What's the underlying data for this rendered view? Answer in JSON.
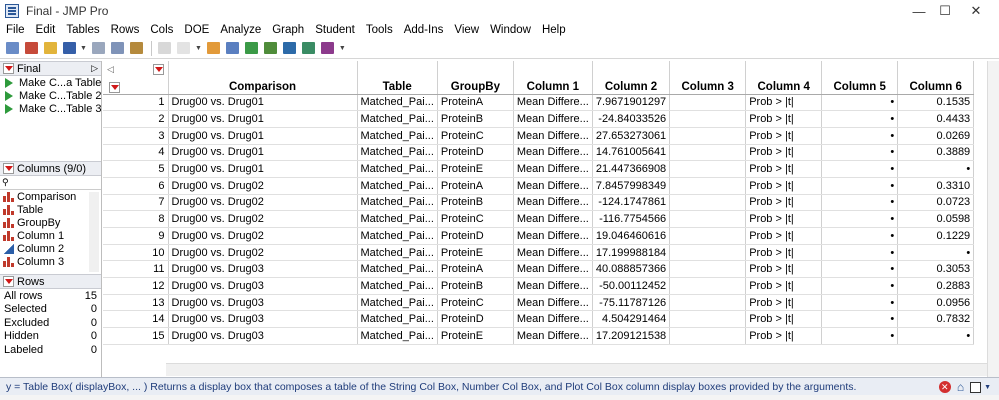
{
  "window": {
    "title": "Final - JMP Pro"
  },
  "menu": [
    "File",
    "Edit",
    "Tables",
    "Rows",
    "Cols",
    "DOE",
    "Analyze",
    "Graph",
    "Student",
    "Tools",
    "Add-Ins",
    "View",
    "Window",
    "Help"
  ],
  "left_panel": {
    "table_name": "Final",
    "scripts": [
      "Make C...a Table",
      "Make C...Table 2",
      "Make C...Table 3"
    ],
    "columns_header": "Columns (9/0)",
    "search_placeholder": "",
    "columns": [
      {
        "name": "Comparison",
        "type": "nominal"
      },
      {
        "name": "Table",
        "type": "nominal"
      },
      {
        "name": "GroupBy",
        "type": "nominal"
      },
      {
        "name": "Column 1",
        "type": "nominal"
      },
      {
        "name": "Column 2",
        "type": "continuous"
      },
      {
        "name": "Column 3",
        "type": "nominal"
      }
    ],
    "rows_header": "Rows",
    "row_stats": [
      {
        "label": "All rows",
        "value": "15"
      },
      {
        "label": "Selected",
        "value": "0"
      },
      {
        "label": "Excluded",
        "value": "0"
      },
      {
        "label": "Hidden",
        "value": "0"
      },
      {
        "label": "Labeled",
        "value": "0"
      }
    ]
  },
  "grid": {
    "headers": [
      "Comparison",
      "Table",
      "GroupBy",
      "Column 1",
      "Column 2",
      "Column 3",
      "Column 4",
      "Column 5",
      "Column 6"
    ],
    "rows": [
      [
        "1",
        "Drug00 vs. Drug01",
        "Matched_Pai...",
        "ProteinA",
        "Mean Differe...",
        "7.9671901297",
        "",
        "Prob > |t|",
        "•",
        "0.1535"
      ],
      [
        "2",
        "Drug00 vs. Drug01",
        "Matched_Pai...",
        "ProteinB",
        "Mean Differe...",
        "-24.84033526",
        "",
        "Prob > |t|",
        "•",
        "0.4433"
      ],
      [
        "3",
        "Drug00 vs. Drug01",
        "Matched_Pai...",
        "ProteinC",
        "Mean Differe...",
        "27.653273061",
        "",
        "Prob > |t|",
        "•",
        "0.0269"
      ],
      [
        "4",
        "Drug00 vs. Drug01",
        "Matched_Pai...",
        "ProteinD",
        "Mean Differe...",
        "14.761005641",
        "",
        "Prob > |t|",
        "•",
        "0.3889"
      ],
      [
        "5",
        "Drug00 vs. Drug01",
        "Matched_Pai...",
        "ProteinE",
        "Mean Differe...",
        "21.447366908",
        "",
        "Prob > |t|",
        "•",
        "•"
      ],
      [
        "6",
        "Drug00 vs. Drug02",
        "Matched_Pai...",
        "ProteinA",
        "Mean Differe...",
        "7.8457998349",
        "",
        "Prob > |t|",
        "•",
        "0.3310"
      ],
      [
        "7",
        "Drug00 vs. Drug02",
        "Matched_Pai...",
        "ProteinB",
        "Mean Differe...",
        "-124.1747861",
        "",
        "Prob > |t|",
        "•",
        "0.0723"
      ],
      [
        "8",
        "Drug00 vs. Drug02",
        "Matched_Pai...",
        "ProteinC",
        "Mean Differe...",
        "-116.7754566",
        "",
        "Prob > |t|",
        "•",
        "0.0598"
      ],
      [
        "9",
        "Drug00 vs. Drug02",
        "Matched_Pai...",
        "ProteinD",
        "Mean Differe...",
        "19.046460616",
        "",
        "Prob > |t|",
        "•",
        "0.1229"
      ],
      [
        "10",
        "Drug00 vs. Drug02",
        "Matched_Pai...",
        "ProteinE",
        "Mean Differe...",
        "17.199988184",
        "",
        "Prob > |t|",
        "•",
        "•"
      ],
      [
        "11",
        "Drug00 vs. Drug03",
        "Matched_Pai...",
        "ProteinA",
        "Mean Differe...",
        "40.088857366",
        "",
        "Prob > |t|",
        "•",
        "0.3053"
      ],
      [
        "12",
        "Drug00 vs. Drug03",
        "Matched_Pai...",
        "ProteinB",
        "Mean Differe...",
        "-50.00112452",
        "",
        "Prob > |t|",
        "•",
        "0.2883"
      ],
      [
        "13",
        "Drug00 vs. Drug03",
        "Matched_Pai...",
        "ProteinC",
        "Mean Differe...",
        "-75.11787126",
        "",
        "Prob > |t|",
        "•",
        "0.0956"
      ],
      [
        "14",
        "Drug00 vs. Drug03",
        "Matched_Pai...",
        "ProteinD",
        "Mean Differe...",
        "4.504291464",
        "",
        "Prob > |t|",
        "•",
        "0.7832"
      ],
      [
        "15",
        "Drug00 vs. Drug03",
        "Matched_Pai...",
        "ProteinE",
        "Mean Differe...",
        "17.209121538",
        "",
        "Prob > |t|",
        "•",
        "•"
      ]
    ]
  },
  "status": {
    "text": "y = Table Box( displayBox, ... )  Returns a display box that composes a table of the String Col Box, Number Col Box, and Plot Col Box column display boxes provided by the arguments."
  }
}
